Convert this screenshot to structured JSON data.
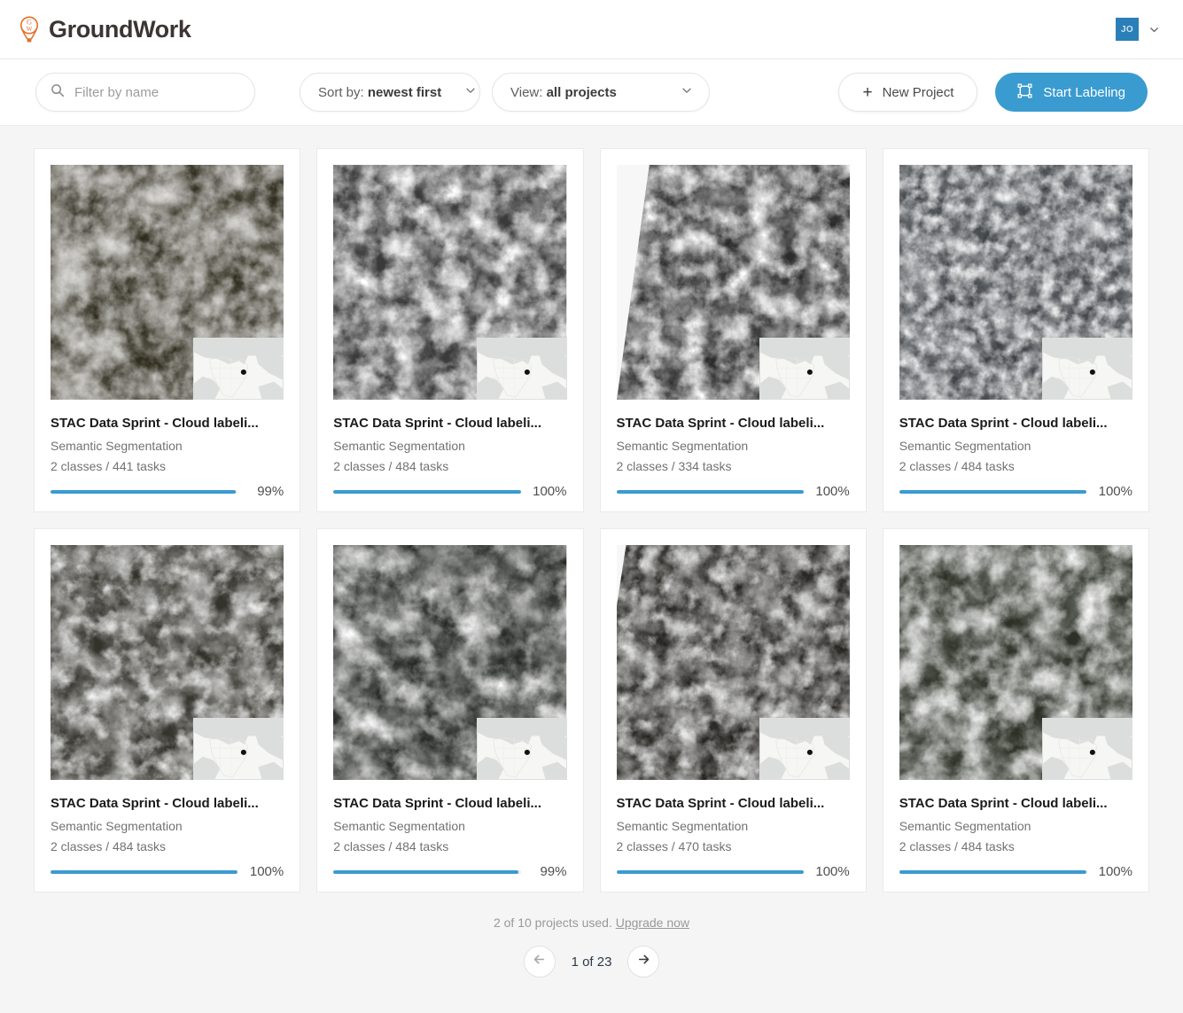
{
  "header": {
    "brand_name": "GroundWork",
    "logo_icon": "balloon-gw-logo",
    "logo_color": "#e2702a",
    "avatar_initials": "JO",
    "avatar_color": "#2a7fb8",
    "user_menu_icon": "chevron-down-icon"
  },
  "toolbar": {
    "search_placeholder": "Filter by name",
    "search_value": "",
    "search_icon": "search-icon",
    "sort": {
      "prefix": "Sort by:",
      "value": "newest first",
      "icon": "chevron-down-icon"
    },
    "view": {
      "prefix": "View:",
      "value": "all projects",
      "icon": "chevron-down-icon"
    },
    "new_project_label": "New Project",
    "new_project_icon": "plus-icon",
    "start_labeling_label": "Start Labeling",
    "start_labeling_icon": "bounding-box-icon",
    "accent_color": "#3a9bd0"
  },
  "projects": [
    {
      "title": "STAC Data Sprint - Cloud labeli...",
      "type": "Semantic Segmentation",
      "meta": "2 classes / 441 tasks",
      "percent": "99%",
      "progress": 99
    },
    {
      "title": "STAC Data Sprint - Cloud labeli...",
      "type": "Semantic Segmentation",
      "meta": "2 classes / 484 tasks",
      "percent": "100%",
      "progress": 100
    },
    {
      "title": "STAC Data Sprint - Cloud labeli...",
      "type": "Semantic Segmentation",
      "meta": "2 classes / 334 tasks",
      "percent": "100%",
      "progress": 100
    },
    {
      "title": "STAC Data Sprint - Cloud labeli...",
      "type": "Semantic Segmentation",
      "meta": "2 classes / 484 tasks",
      "percent": "100%",
      "progress": 100
    },
    {
      "title": "STAC Data Sprint - Cloud labeli...",
      "type": "Semantic Segmentation",
      "meta": "2 classes / 484 tasks",
      "percent": "100%",
      "progress": 100
    },
    {
      "title": "STAC Data Sprint - Cloud labeli...",
      "type": "Semantic Segmentation",
      "meta": "2 classes / 484 tasks",
      "percent": "99%",
      "progress": 99
    },
    {
      "title": "STAC Data Sprint - Cloud labeli...",
      "type": "Semantic Segmentation",
      "meta": "2 classes / 470 tasks",
      "percent": "100%",
      "progress": 100
    },
    {
      "title": "STAC Data Sprint - Cloud labeli...",
      "type": "Semantic Segmentation",
      "meta": "2 classes / 484 tasks",
      "percent": "100%",
      "progress": 100
    }
  ],
  "footer": {
    "quota_text": "2 of 10 projects used.",
    "upgrade_label": "Upgrade now",
    "page_text": "1 of 23",
    "prev_icon": "arrow-left-icon",
    "next_icon": "arrow-right-icon"
  }
}
